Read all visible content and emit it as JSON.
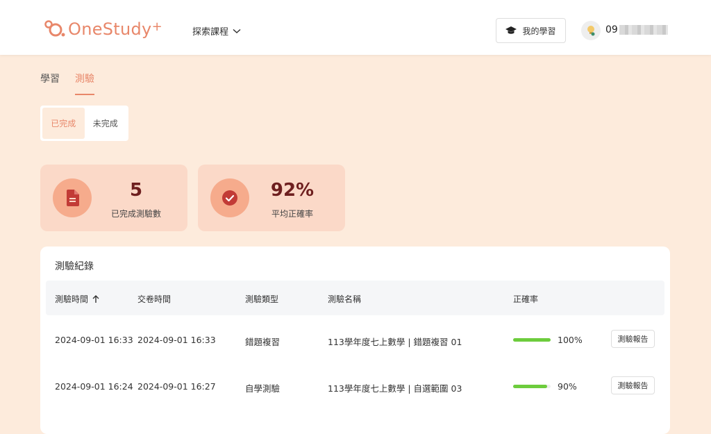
{
  "header": {
    "brand": "OneStudy",
    "brand_plus": "+",
    "explore_label": "探索課程",
    "my_learning_label": "我的學習",
    "user_id": "09"
  },
  "tabs": [
    {
      "label": "學習",
      "active": false
    },
    {
      "label": "測驗",
      "active": true
    }
  ],
  "status_filter": [
    {
      "label": "已完成",
      "active": true
    },
    {
      "label": "未完成",
      "active": false
    }
  ],
  "stats": [
    {
      "icon": "document-icon",
      "value": "5",
      "label": "已完成測驗數"
    },
    {
      "icon": "check-circle-icon",
      "value": "92%",
      "label": "平均正確率"
    }
  ],
  "records": {
    "title": "測驗紀錄",
    "columns": [
      "測驗時間",
      "交卷時間",
      "測驗類型",
      "測驗名稱",
      "正確率"
    ],
    "rows": [
      {
        "start": "2024-09-01 16:33",
        "submit": "2024-09-01 16:33",
        "type": "錯題複習",
        "name": "113學年度七上數學 | 錯題複習 01",
        "accuracy": 100,
        "accuracy_label": "100%",
        "action": "測驗報告"
      },
      {
        "start": "2024-09-01 16:24",
        "submit": "2024-09-01 16:27",
        "type": "自學測驗",
        "name": "113學年度七上數學 | 自選範圍 03",
        "accuracy": 90,
        "accuracy_label": "90%",
        "action": "測驗報告"
      }
    ]
  },
  "colors": {
    "accent": "#e8876a",
    "background": "#fdebdc",
    "stat_card": "#fbd9c8",
    "progress": "#6dcc3d",
    "stat_value": "#6e1f1f"
  }
}
